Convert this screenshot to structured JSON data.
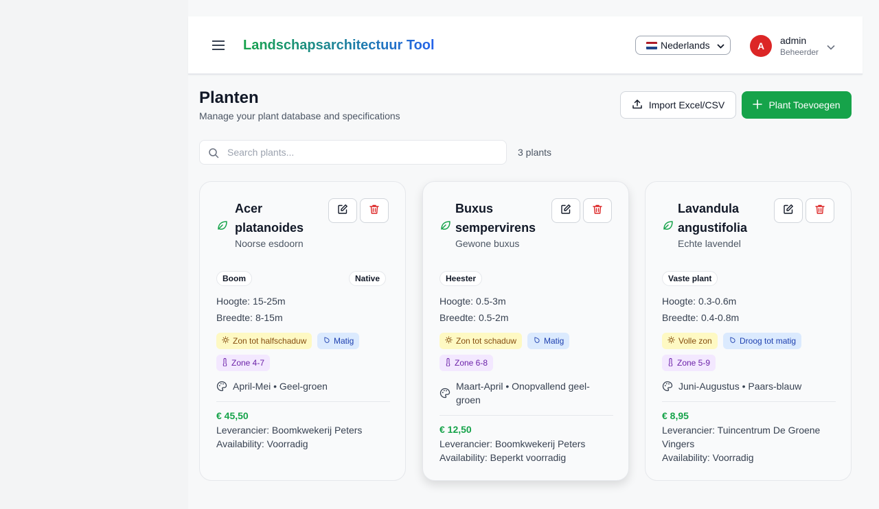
{
  "header": {
    "app_title": "Landschapsarchitectuur Tool",
    "language": "Nederlands",
    "user": {
      "initial": "A",
      "name": "admin",
      "role": "Beheerder"
    }
  },
  "page": {
    "title": "Planten",
    "subtitle": "Manage your plant database and specifications",
    "import_label": "Import Excel/CSV",
    "add_label": "Plant Toevoegen",
    "search_placeholder": "Search plants...",
    "count": "3 plants"
  },
  "plants": [
    {
      "name": "Acer platanoides",
      "common": "Noorse esdoorn",
      "type": "Boom",
      "native": "Native",
      "height_label": "Hoogte:",
      "height": "15-25m",
      "width_label": "Breedte:",
      "width": "8-15m",
      "sun": "Zon tot halfschaduw",
      "water": "Matig",
      "zone": "Zone 4-7",
      "bloom": "April-Mei • Geel-groen",
      "price": "€ 45,50",
      "supplier": "Leverancier: Boomkwekerij Peters",
      "availability": "Availability: Voorradig"
    },
    {
      "name": "Buxus sempervirens",
      "common": "Gewone buxus",
      "type": "Heester",
      "height_label": "Hoogte:",
      "height": "0.5-3m",
      "width_label": "Breedte:",
      "width": "0.5-2m",
      "sun": "Zon tot schaduw",
      "water": "Matig",
      "zone": "Zone 6-8",
      "bloom": "Maart-April • Onopvallend geel-groen",
      "price": "€ 12,50",
      "supplier": "Leverancier: Boomkwekerij Peters",
      "availability": "Availability: Beperkt voorradig"
    },
    {
      "name": "Lavandula angustifolia",
      "common": "Echte lavendel",
      "type": "Vaste plant",
      "height_label": "Hoogte:",
      "height": "0.3-0.6m",
      "width_label": "Breedte:",
      "width": "0.4-0.8m",
      "sun": "Volle zon",
      "water": "Droog tot matig",
      "zone": "Zone 5-9",
      "bloom": "Juni-Augustus • Paars-blauw",
      "price": "€ 8,95",
      "supplier": "Leverancier: Tuincentrum De Groene Vingers",
      "availability": "Availability: Voorradig"
    }
  ]
}
